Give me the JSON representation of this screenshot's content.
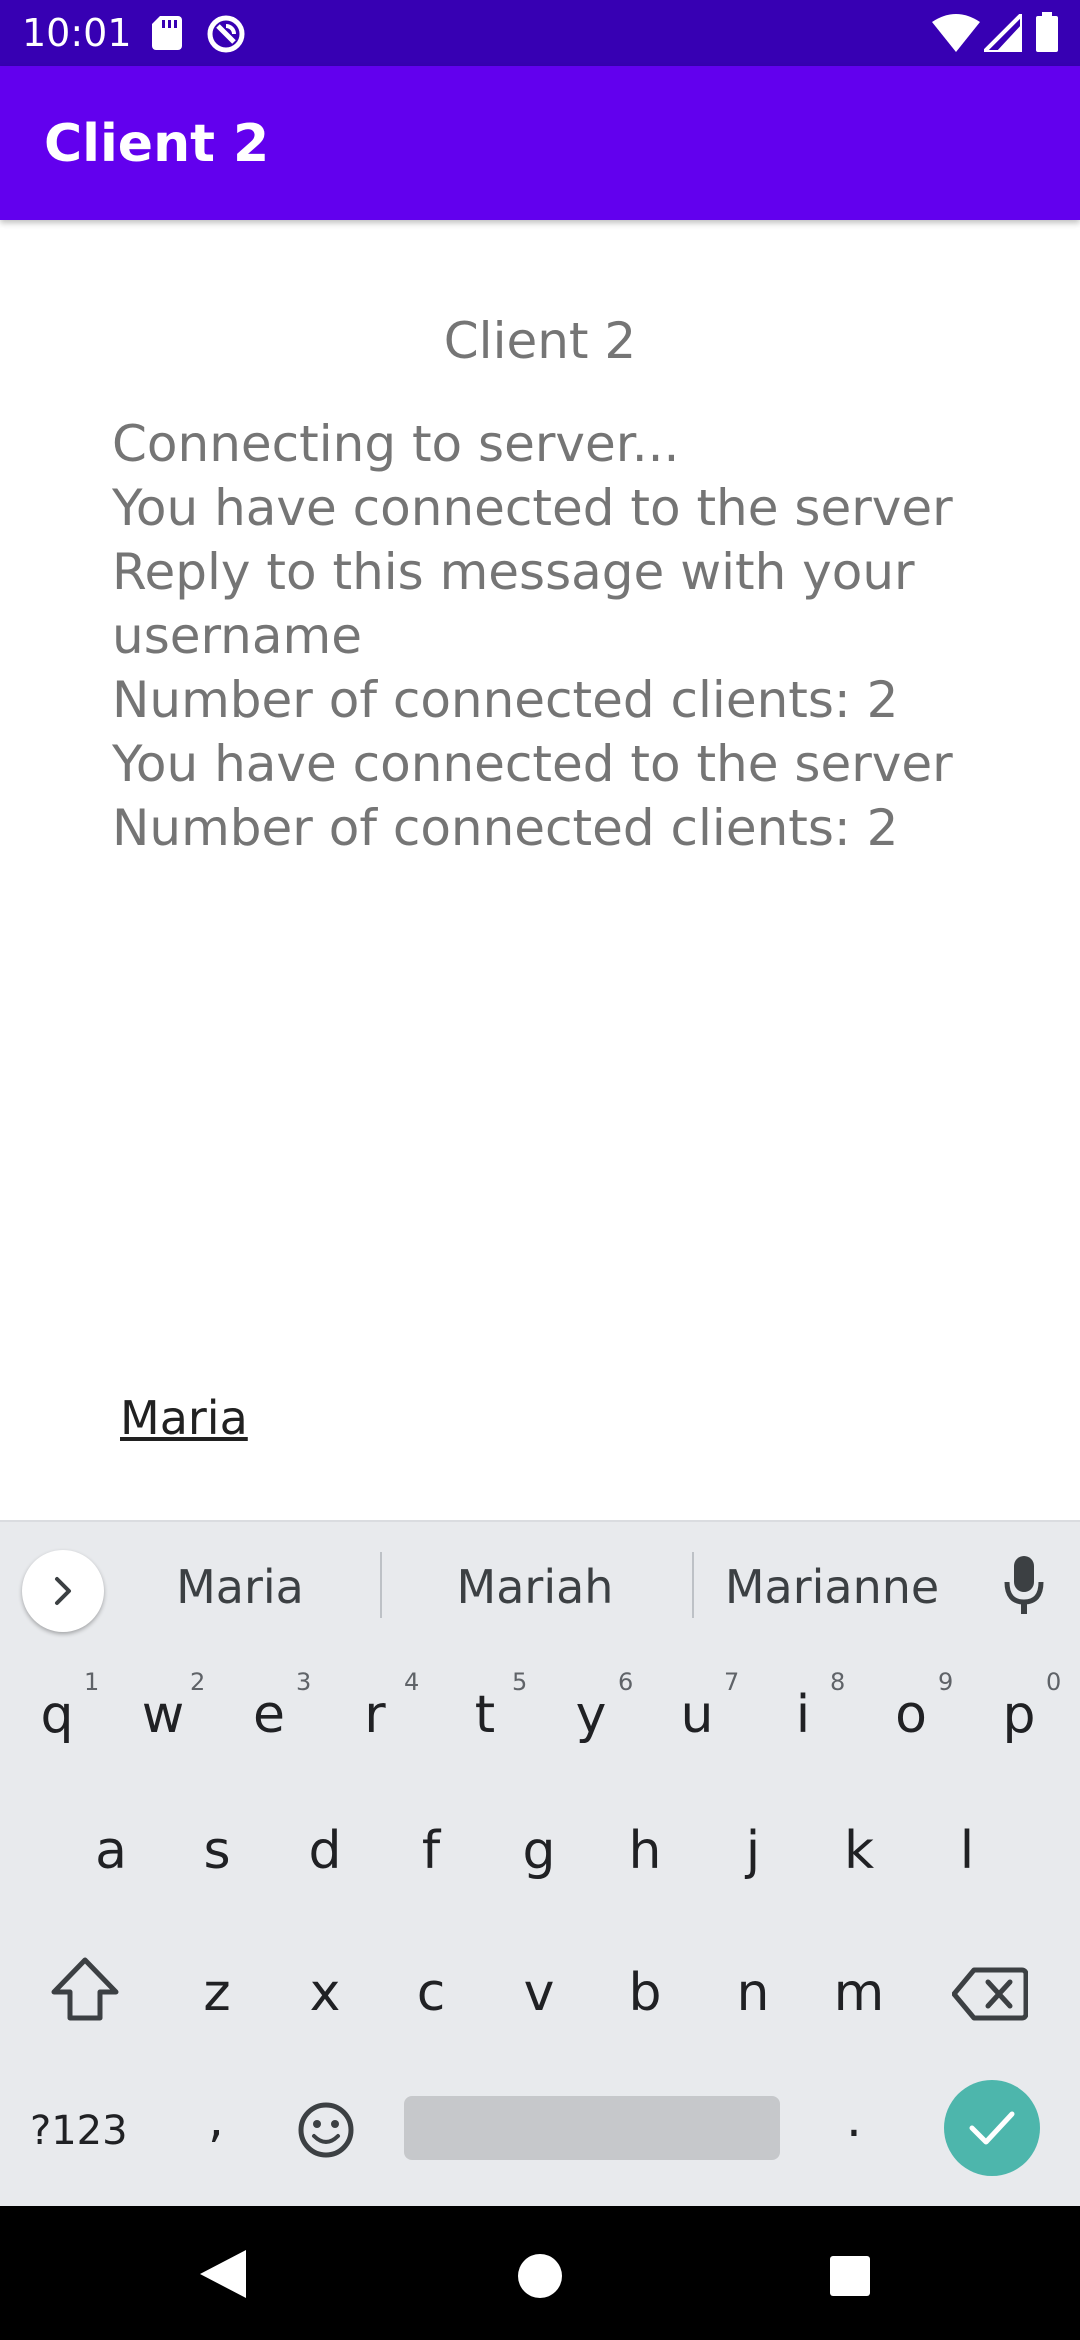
{
  "status_bar": {
    "time": "10:01",
    "icons": [
      "sd-card-icon",
      "sync-icon",
      "wifi-icon",
      "signal-icon",
      "battery-icon"
    ]
  },
  "app_bar": {
    "title": "Client 2"
  },
  "main": {
    "title": "Client 2",
    "log": [
      "Connecting to server...",
      "You have connected to the server",
      "Reply to this message with your username",
      "Number of connected clients: 2",
      "You have connected to the server",
      "Number of connected clients: 2"
    ],
    "input_value": "Maria"
  },
  "keyboard": {
    "suggestions": [
      "Maria",
      "Mariah",
      "Marianne"
    ],
    "row1": [
      "q",
      "w",
      "e",
      "r",
      "t",
      "y",
      "u",
      "i",
      "o",
      "p"
    ],
    "row1_hints": [
      "1",
      "2",
      "3",
      "4",
      "5",
      "6",
      "7",
      "8",
      "9",
      "0"
    ],
    "row2": [
      "a",
      "s",
      "d",
      "f",
      "g",
      "h",
      "j",
      "k",
      "l"
    ],
    "row3": [
      "z",
      "x",
      "c",
      "v",
      "b",
      "n",
      "m"
    ],
    "symbols_label": "?123",
    "comma": ",",
    "period": ".",
    "accent_color": "#4db6ac"
  },
  "colors": {
    "status_bar": "#3700b3",
    "app_bar": "#6200ee"
  }
}
